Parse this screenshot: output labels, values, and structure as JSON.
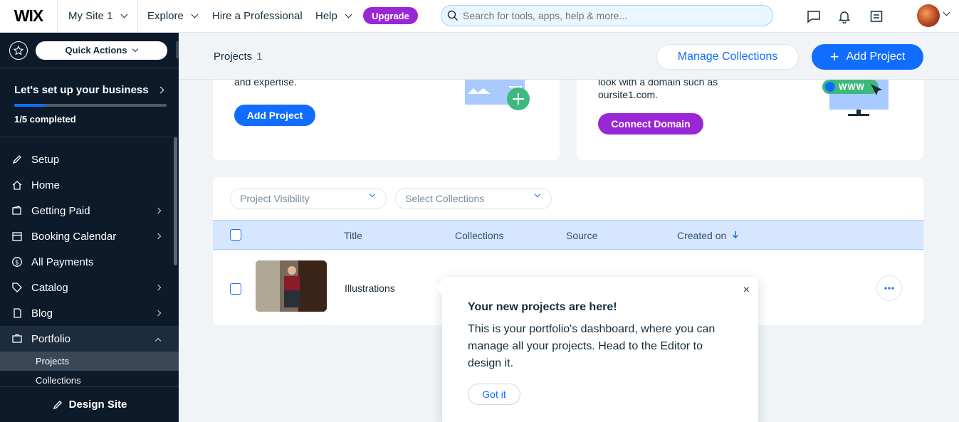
{
  "topbar": {
    "logo": "WIX",
    "site_name": "My Site 1",
    "nav": [
      "Explore",
      "Hire a Professional",
      "Help"
    ],
    "upgrade": "Upgrade",
    "search_placeholder": "Search for tools, apps, help & more..."
  },
  "sidebar": {
    "quick_actions": "Quick Actions",
    "setup_title": "Let's set up your business",
    "setup_progress": "1/5 completed",
    "setup_fraction": 0.2,
    "items": [
      {
        "label": "Setup"
      },
      {
        "label": "Home"
      },
      {
        "label": "Getting Paid"
      },
      {
        "label": "Booking Calendar"
      },
      {
        "label": "All Payments"
      },
      {
        "label": "Catalog"
      },
      {
        "label": "Blog"
      },
      {
        "label": "Portfolio"
      }
    ],
    "subitems": [
      "Projects",
      "Collections"
    ],
    "design_site": "Design Site"
  },
  "header": {
    "title": "Projects",
    "count": "1",
    "manage_collections": "Manage Collections",
    "add_project": "Add Project"
  },
  "cards": {
    "left_text": "and expertise.",
    "left_button": "Add Project",
    "right_text_1": "look with a domain such as",
    "right_text_2": "oursite1.com.",
    "right_button": "Connect Domain",
    "www_badge": "WWW"
  },
  "table": {
    "filter_visibility": "Project Visibility",
    "filter_collections": "Select Collections",
    "columns": [
      "Title",
      "Collections",
      "Source",
      "Created on"
    ],
    "rows": [
      {
        "title": "Illustrations"
      }
    ]
  },
  "tooltip": {
    "close": "×",
    "title": "Your new projects are here!",
    "body": "This is your portfolio's dashboard, where you can manage all your projects. Head to the Editor to design it.",
    "button": "Got it"
  },
  "colors": {
    "primary": "#116dff",
    "purple": "#9a27d5",
    "sidebar_bg": "#0c1a2a",
    "table_header": "#d6e6fe"
  }
}
